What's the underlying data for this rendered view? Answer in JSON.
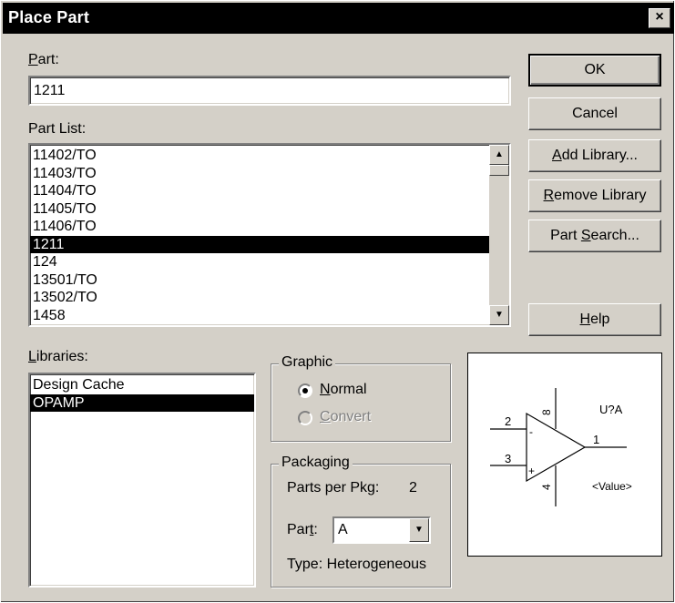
{
  "window": {
    "title": "Place Part",
    "close_glyph": "×"
  },
  "part": {
    "label": "Part:",
    "label_ul": "P",
    "label_rest": "art:",
    "value": "1211"
  },
  "part_list": {
    "label": "Part List:",
    "items": [
      "11402/TO",
      "11403/TO",
      "11404/TO",
      "11405/TO",
      "11406/TO",
      "1211",
      "124",
      "13501/TO",
      "13502/TO",
      "1458"
    ],
    "selected_index": 5
  },
  "libraries": {
    "label_ul": "L",
    "label_rest": "ibraries:",
    "items": [
      "Design Cache",
      "OPAMP"
    ],
    "selected_index": 1
  },
  "buttons": {
    "ok": "OK",
    "cancel": "Cancel",
    "add_library_ul": "A",
    "add_library_rest": "dd Library...",
    "remove_library_ul": "R",
    "remove_library_rest": "emove Library",
    "part_search_pre": "Part ",
    "part_search_ul": "S",
    "part_search_rest": "earch...",
    "help_ul": "H",
    "help_rest": "elp"
  },
  "graphic": {
    "title": "Graphic",
    "normal_ul": "N",
    "normal_rest": "ormal",
    "convert_ul": "C",
    "convert_rest": "onvert",
    "selected": "normal"
  },
  "packaging": {
    "title": "Packaging",
    "parts_per_pkg_label": "Parts per Pkg:",
    "parts_per_pkg_value": "2",
    "part_label_pre": "Par",
    "part_label_ul": "t",
    "part_label_rest": ":",
    "part_value": "A",
    "type_label": "Type:",
    "type_value": "Heterogeneous"
  },
  "preview": {
    "ref": "U?A",
    "value": "<Value>",
    "pin_in_neg": "2",
    "pin_in_pos": "3",
    "pin_out": "1",
    "pin_vcc": "8",
    "pin_gnd": "4",
    "minus": "-",
    "plus": "+"
  },
  "icons": {
    "scroll_up": "up-arrow-icon",
    "scroll_down": "down-arrow-icon",
    "combo": "chevron-down-icon"
  },
  "colors": {
    "face": "#d4d0c8",
    "titlebar": "#000000",
    "selection": "#000000"
  }
}
